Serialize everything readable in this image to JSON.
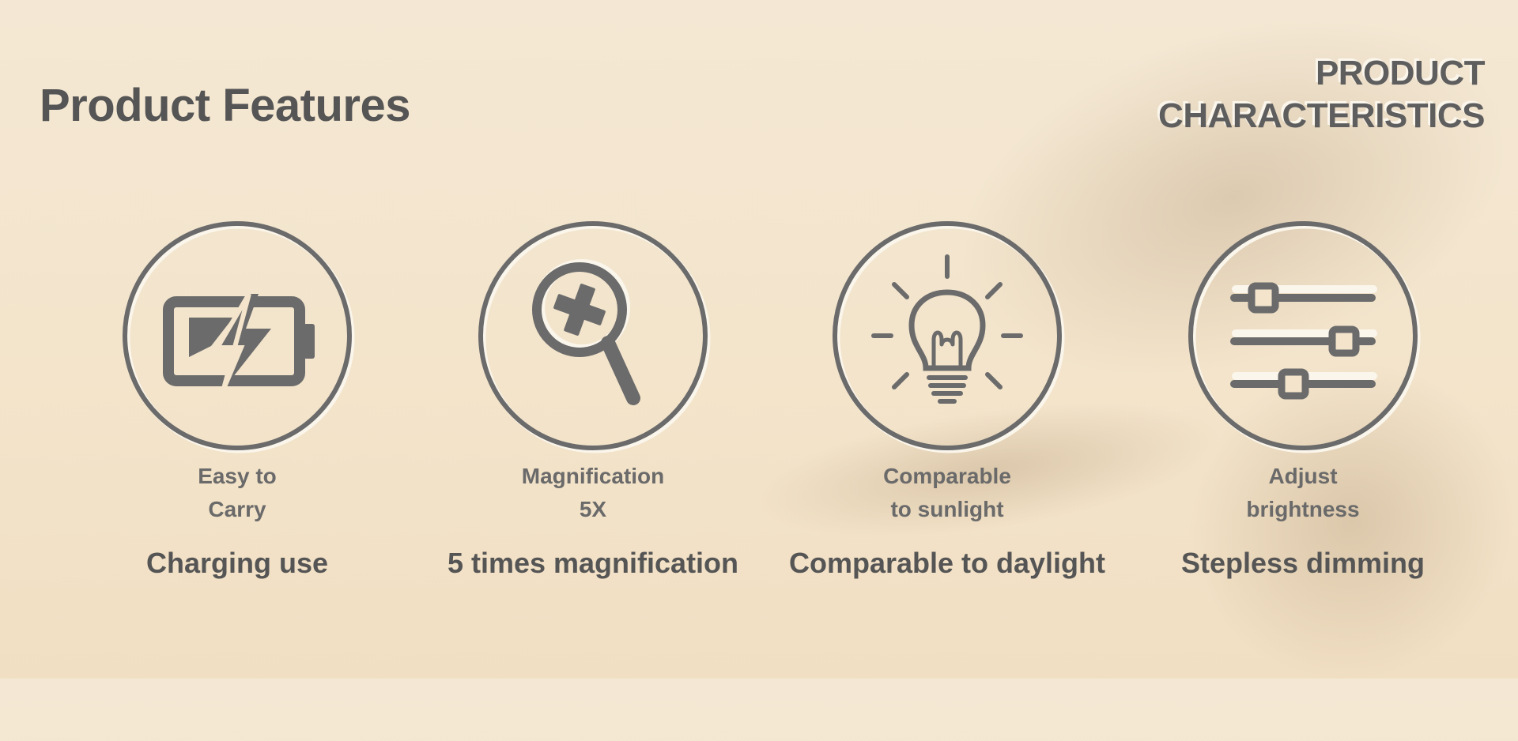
{
  "page": {
    "title": "Product Features",
    "corner_label": [
      "PRODUCT",
      "CHARACTERISTICS"
    ]
  },
  "colors": {
    "background": "#f3e4cb",
    "icon": "#6b6b6b",
    "text": "#555555",
    "highlight": "#fbf6ec"
  },
  "features": [
    {
      "icon": "battery-charging-icon",
      "subtitle": [
        "Easy to",
        "Carry"
      ],
      "caption": "Charging use"
    },
    {
      "icon": "magnifier-plus-icon",
      "subtitle": [
        "Magnification",
        "5X"
      ],
      "caption": "5 times magnification"
    },
    {
      "icon": "light-bulb-icon",
      "subtitle": [
        "Comparable",
        "to sunlight"
      ],
      "caption": "Comparable to daylight"
    },
    {
      "icon": "sliders-icon",
      "subtitle": [
        "Adjust",
        "brightness"
      ],
      "caption": "Stepless dimming"
    }
  ]
}
